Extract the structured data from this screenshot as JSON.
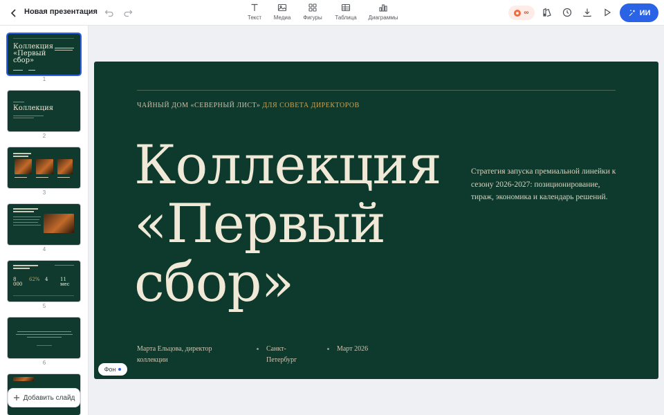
{
  "header": {
    "doc_title": "Новая презентация",
    "tools": [
      {
        "label": "Текст",
        "icon": "text-icon"
      },
      {
        "label": "Медиа",
        "icon": "image-icon"
      },
      {
        "label": "Фигуры",
        "icon": "shapes-icon"
      },
      {
        "label": "Таблица",
        "icon": "table-icon"
      },
      {
        "label": "Диаграммы",
        "icon": "chart-icon"
      }
    ],
    "credits_label": "∞",
    "ai_button_label": "ИИ",
    "accent_color": "#2b63e6",
    "credits_color": "#f26b3a"
  },
  "sidebar": {
    "slide_numbers": [
      "1",
      "2",
      "3",
      "4",
      "5",
      "6"
    ],
    "selected_slide": 1,
    "add_slide_label": "Добавить слайд",
    "thumbnails": {
      "s1_title": "Коллекция «Первый сбор»",
      "s2_title": "Коллекция",
      "s5_stats": [
        "8 000",
        "62%",
        "4",
        "11 мес"
      ]
    }
  },
  "slide": {
    "background_color": "#0d3a2c",
    "eyebrow_part1": "ЧАЙНЫЙ ДОМ «СЕВЕРНЫЙ ЛИСТ»",
    "eyebrow_part2": "ДЛЯ СОВЕТА ДИРЕКТОРОВ",
    "title_lines": [
      "Коллекция",
      "«Первый",
      "сбор»"
    ],
    "lead": "Стратегия запуска премиальной линейки к сезону 2026-2027: позиционирование, тираж, экономика и календарь решений.",
    "author": "Марта Ельцова, директор коллекции",
    "city": "Санкт-Петербург",
    "date": "Март 2026"
  },
  "background_chip_label": "Фон"
}
